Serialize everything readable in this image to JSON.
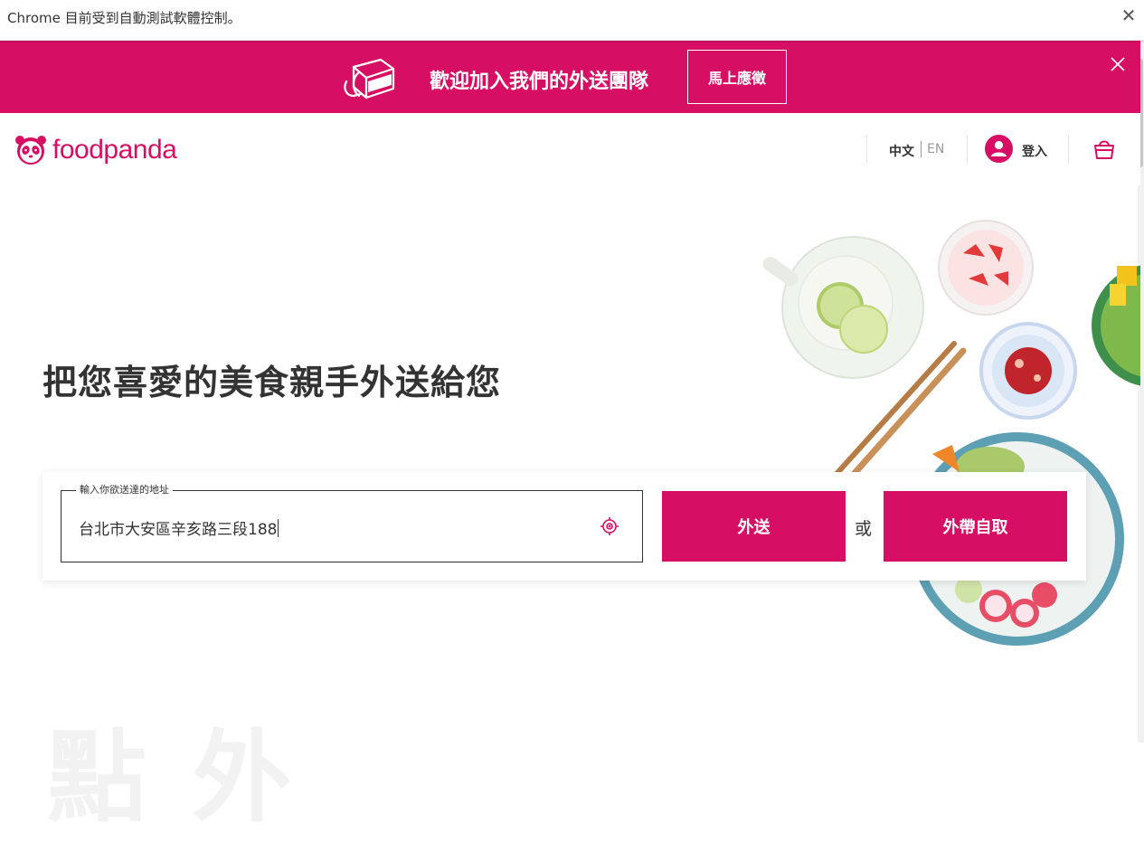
{
  "chrome": {
    "automation_message": "Chrome 目前受到自動測試軟體控制。",
    "close_glyph": "✕"
  },
  "banner": {
    "text": "歡迎加入我們的外送團隊",
    "apply_label": "馬上應徵",
    "background": "#d70f64"
  },
  "header": {
    "brand": "foodpanda",
    "lang_zh": "中文",
    "lang_en": "EN",
    "login_label": "登入"
  },
  "hero": {
    "headline": "把您喜愛的美食親手外送給您",
    "background_text": "點 外"
  },
  "search": {
    "field_label": "輸入你欲送達的地址",
    "address_value": "台北市大安區辛亥路三段188",
    "delivery_label": "外送",
    "or_label": "或",
    "pickup_label": "外帶自取"
  },
  "icons": {
    "banner": "delivery-bag-icon",
    "banner_close": "close-icon",
    "logo": "panda-icon",
    "user": "user-icon",
    "cart": "shopping-bag-icon",
    "locate": "locate-target-icon"
  },
  "colors": {
    "brand": "#d70f64",
    "text": "#333333"
  }
}
